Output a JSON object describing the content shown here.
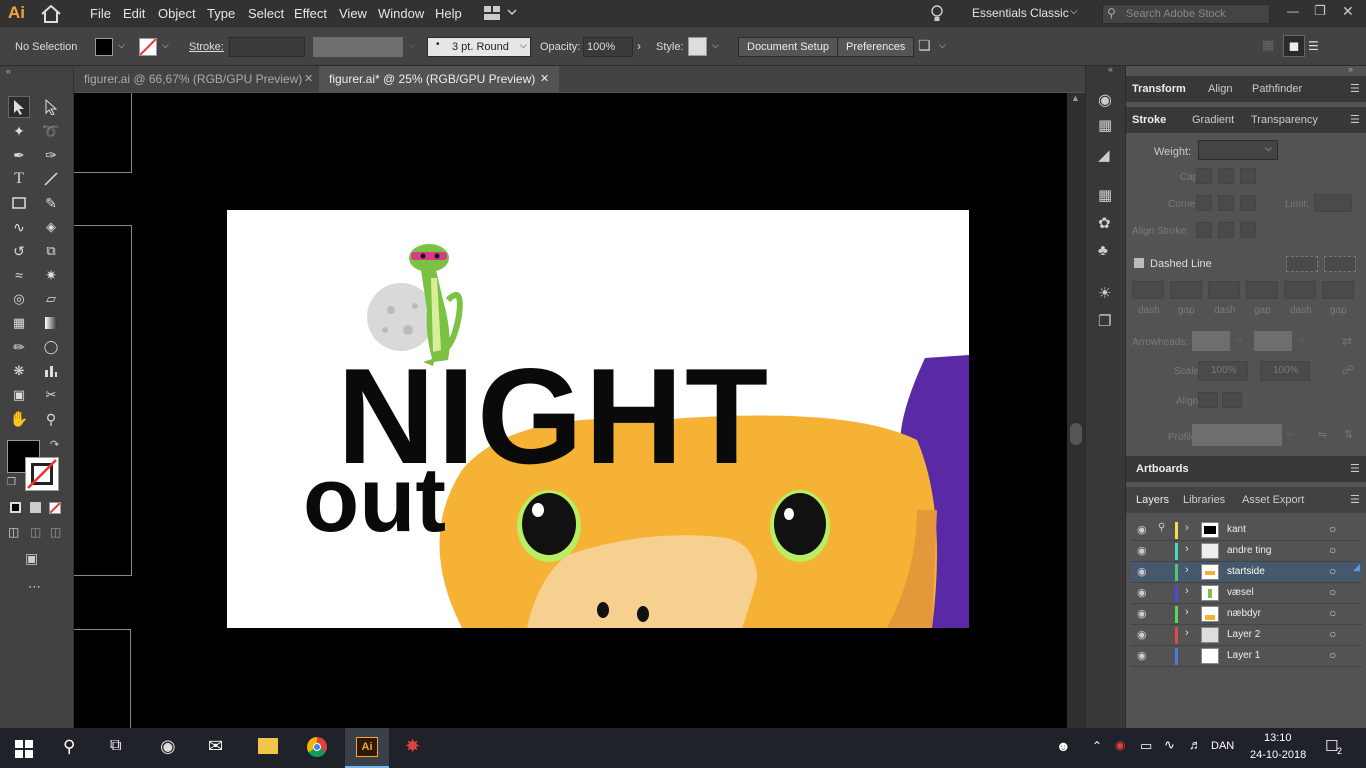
{
  "app": {
    "logo": "Ai"
  },
  "menu": [
    "File",
    "Edit",
    "Object",
    "Type",
    "Select",
    "Effect",
    "View",
    "Window",
    "Help"
  ],
  "workspace": "Essentials Classic",
  "search_placeholder": "Search Adobe Stock",
  "control": {
    "selection": "No Selection",
    "stroke_label": "Stroke:",
    "brush": "3 pt. Round",
    "opacity_label": "Opacity:",
    "opacity_value": "100%",
    "style_label": "Style:",
    "document_setup": "Document Setup",
    "preferences": "Preferences"
  },
  "doc_tabs": [
    {
      "label": "figurer.ai @ 66,67% (RGB/GPU Preview)",
      "active": false
    },
    {
      "label": "figurer.ai* @ 25% (RGB/GPU Preview)",
      "active": true
    }
  ],
  "artwork": {
    "title": "NIGHT",
    "subtitle": "out"
  },
  "panels": {
    "top_tabs": [
      "Transform",
      "Align",
      "Pathfinder"
    ],
    "stroke_tabs": [
      "Stroke",
      "Gradient",
      "Transparency"
    ],
    "weight_label": "Weight:",
    "cap_label": "Cap:",
    "corner_label": "Corner:",
    "limit_label": "Limit:",
    "align_stroke_label": "Align Stroke:",
    "dashed_line": "Dashed Line",
    "dash_labels": [
      "dash",
      "gap",
      "dash",
      "gap",
      "dash",
      "gap"
    ],
    "arrowheads_label": "Arrowheads:",
    "scale_label": "Scale:",
    "scale_value": "100%",
    "scale_value2": "100%",
    "align_label": "Align:",
    "profile_label": "Profile:",
    "artboards": "Artboards",
    "layer_tabs": [
      "Layers",
      "Libraries",
      "Asset Export"
    ]
  },
  "layers": [
    {
      "name": "kant",
      "color": "#f0e24a",
      "locked": true,
      "selected": false
    },
    {
      "name": "andre ting",
      "color": "#4ad6c8",
      "locked": false,
      "selected": false
    },
    {
      "name": "startside",
      "color": "#4acb6a",
      "locked": false,
      "selected": true
    },
    {
      "name": "væsel",
      "color": "#4a4adf",
      "locked": false,
      "selected": false
    },
    {
      "name": "næbdyr",
      "color": "#5ad65a",
      "locked": false,
      "selected": false
    },
    {
      "name": "Layer 2",
      "color": "#e04a4a",
      "locked": false,
      "selected": false
    },
    {
      "name": "Layer 1",
      "color": "#4a7adf",
      "locked": false,
      "selected": false
    }
  ],
  "taskbar": {
    "time": "13:10",
    "date": "24-10-2018",
    "lang": "DAN",
    "notif": "2"
  }
}
